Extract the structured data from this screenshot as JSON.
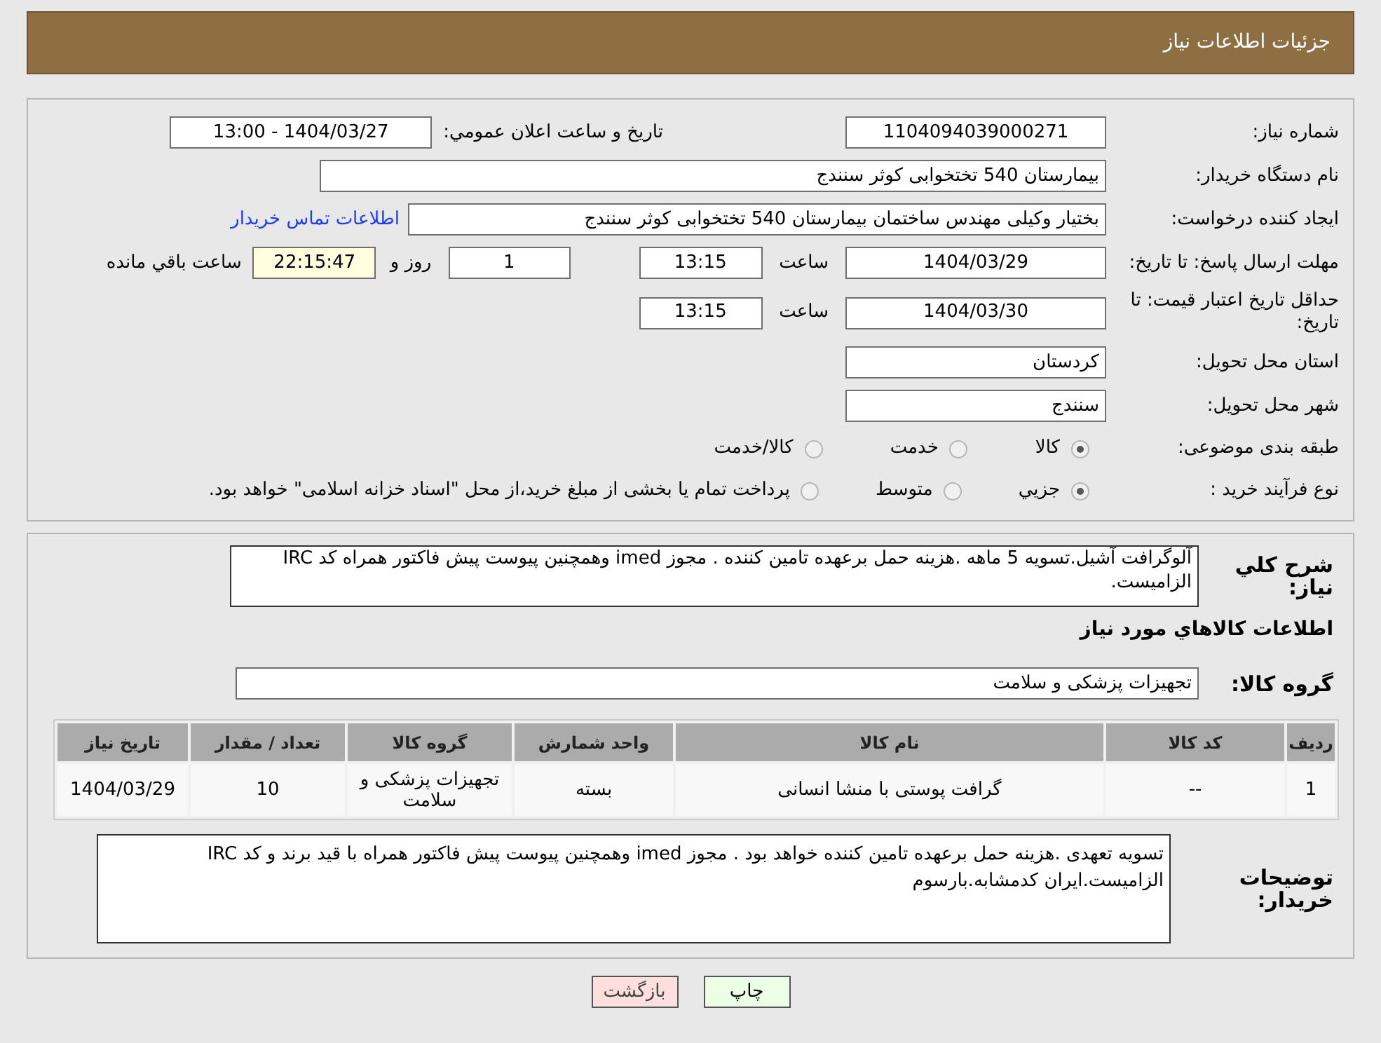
{
  "header": {
    "title": "جزئیات اطلاعات نیاز"
  },
  "need_number": {
    "label": "شماره نیاز:",
    "value": "1104094039000271"
  },
  "announce": {
    "label": "تاریخ و ساعت اعلان عمومي:",
    "value": "1404/03/27 - 13:00"
  },
  "buyer": {
    "label": "نام دستگاه خریدار:",
    "value": "بیمارستان 540 تختخوابی کوثر سنندج"
  },
  "creator": {
    "label": "ایجاد کننده درخواست:",
    "value": "بختیار وکیلی مهندس ساختمان بیمارستان 540 تختخوابی کوثر سنندج",
    "link": "اطلاعات تماس خریدار"
  },
  "deadline": {
    "label": "مهلت ارسال پاسخ: تا تاریخ:",
    "date": "1404/03/29",
    "time_label": "ساعت",
    "time": "13:15",
    "days": "1",
    "days_label": "روز و",
    "remaining": "22:15:47",
    "remaining_label": "ساعت باقي مانده"
  },
  "validity": {
    "label": "حداقل تاریخ اعتبار قیمت: تا تاریخ:",
    "date": "1404/03/30",
    "time_label": "ساعت",
    "time": "13:15"
  },
  "province": {
    "label": "استان محل تحویل:",
    "value": "کردستان"
  },
  "city": {
    "label": "شهر محل تحویل:",
    "value": "سنندج"
  },
  "category": {
    "label": "طبقه بندی موضوعی:",
    "options": [
      {
        "label": "کالا",
        "selected": true
      },
      {
        "label": "خدمت",
        "selected": false
      },
      {
        "label": "کالا/خدمت",
        "selected": false
      }
    ]
  },
  "process": {
    "label": "نوع فرآیند خرید :",
    "options": [
      {
        "label": "جزيي",
        "selected": true
      },
      {
        "label": "متوسط",
        "selected": false
      },
      {
        "label": "پرداخت تمام یا بخشی از مبلغ خرید،از محل \"اسناد خزانه اسلامی\" خواهد بود.",
        "selected": false
      }
    ]
  },
  "description": {
    "label": "شرح کلي نیاز:",
    "value": "آلوگرافت آشیل.تسویه 5 ماهه .هزینه حمل برعهده تامین کننده . مجوز imed وهمچنین پیوست پیش فاکتور همراه کد IRC  الزامیست."
  },
  "goods_title": "اطلاعات کالاهاي مورد نیاز",
  "goods_group": {
    "label": "گروه کالا:",
    "value": "تجهیزات پزشکی و سلامت"
  },
  "table": {
    "columns": [
      "ردیف",
      "کد کالا",
      "نام کالا",
      "واحد شمارش",
      "گروه کالا",
      "تعداد / مقدار",
      "تاریخ نیاز"
    ],
    "rows": [
      [
        "1",
        "--",
        "گرافت پوستی با منشا انسانی",
        "بسته",
        "تجهیزات پزشکی و سلامت",
        "10",
        "1404/03/29"
      ]
    ]
  },
  "buyer_notes": {
    "label": "توضیحات خریدار:",
    "value": "تسویه تعهدی .هزینه حمل برعهده تامین کننده خواهد بود . مجوز imed وهمچنین پیوست پیش فاکتور همراه  با قید برند و کد IRC  الزامیست.ایران کدمشابه.بارسوم"
  },
  "buttons": [
    {
      "label": "چاپ",
      "kind": "print"
    },
    {
      "label": "بازگشت",
      "kind": "back"
    }
  ]
}
